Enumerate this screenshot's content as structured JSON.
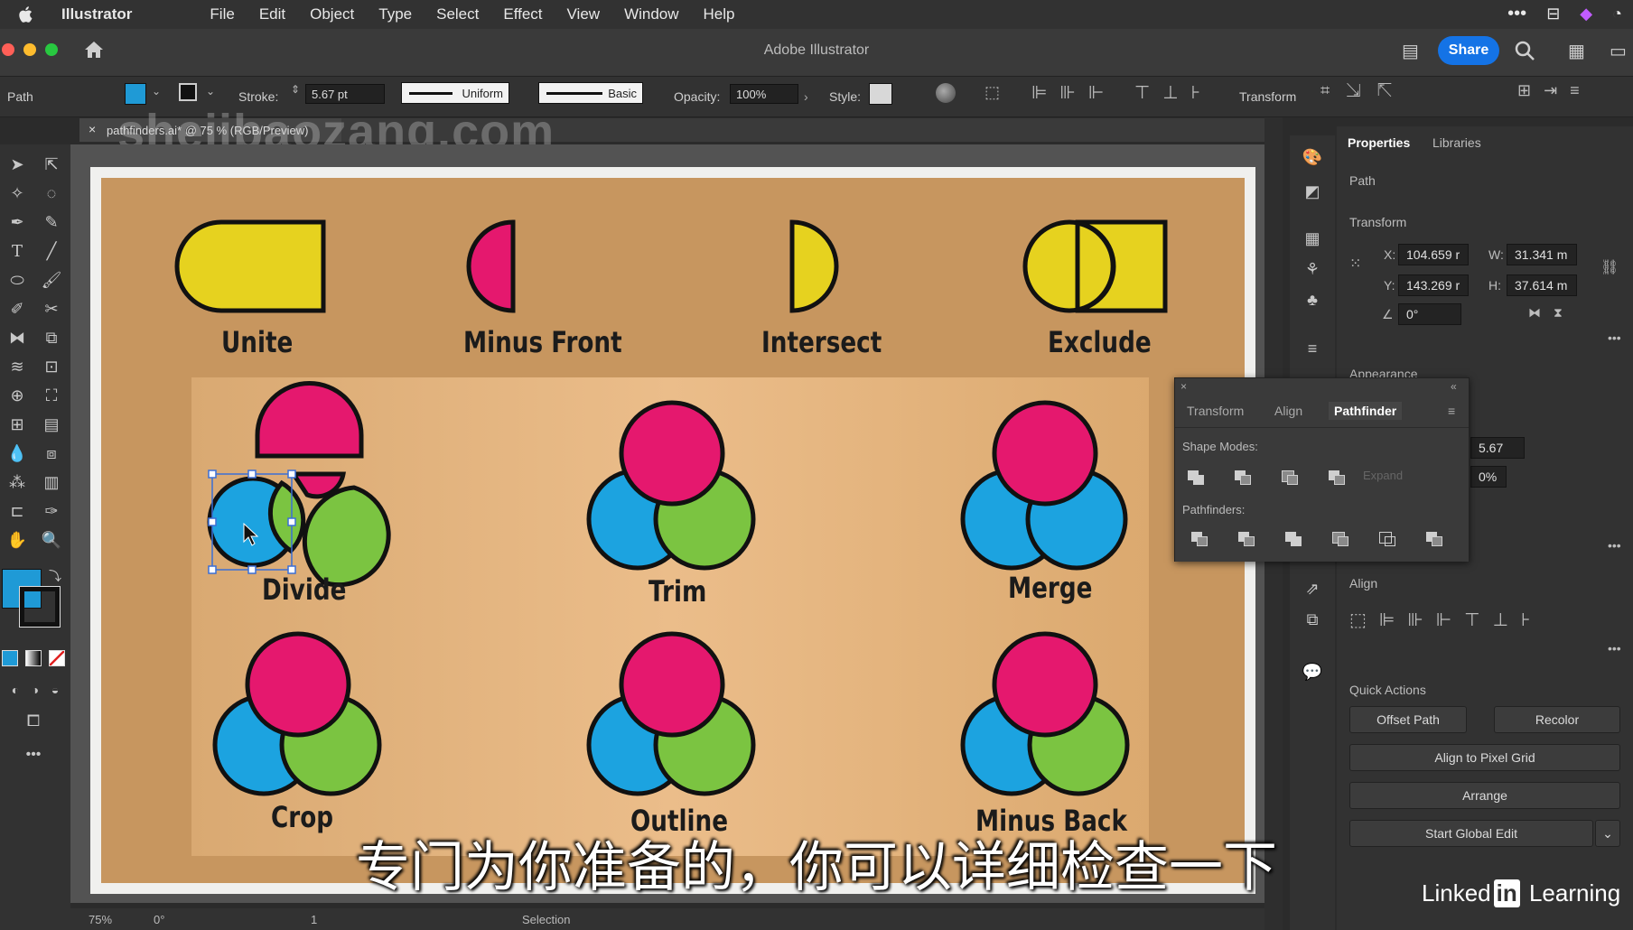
{
  "menubar": {
    "app_name": "Illustrator",
    "items": [
      "File",
      "Edit",
      "Object",
      "Type",
      "Select",
      "Effect",
      "View",
      "Window",
      "Help"
    ]
  },
  "titlebar": {
    "title": "Adobe Illustrator",
    "share_label": "Share"
  },
  "controlbar": {
    "selection_type": "Path",
    "stroke_label": "Stroke:",
    "stroke_value": "5.67 pt",
    "profile_label": "Uniform",
    "brush_label": "Basic",
    "opacity_label": "Opacity:",
    "opacity_value": "100%",
    "style_label": "Style:",
    "transform_label": "Transform",
    "fill_color": "#1f9ad6"
  },
  "document_tab": {
    "name": "pathfinders.ai* @ 75 % (RGB/Preview)",
    "watermark": "shejibaozang.com"
  },
  "artboard": {
    "labels": {
      "unite": "Unite",
      "minus_front": "Minus Front",
      "intersect": "Intersect",
      "exclude": "Exclude",
      "divide": "Divide",
      "trim": "Trim",
      "merge": "Merge",
      "crop": "Crop",
      "outline": "Outline",
      "minus_back": "Minus Back"
    },
    "colors": {
      "magenta": "#e5186e",
      "blue": "#1ca3e0",
      "green": "#7bc441",
      "yellow": "#e6d21f"
    }
  },
  "statusbar": {
    "zoom": "75%",
    "rotation": "0°",
    "artboard_number": "1",
    "tool": "Selection"
  },
  "properties_panel": {
    "tabs": [
      "Properties",
      "Libraries"
    ],
    "selection": "Path",
    "transform_heading": "Transform",
    "x_label": "X:",
    "x_value": "104.659 r",
    "y_label": "Y:",
    "y_value": "143.269 r",
    "w_label": "W:",
    "w_value": "31.341 m",
    "h_label": "H:",
    "h_value": "37.614 m",
    "angle_value": "0°",
    "appearance_heading": "Appearance",
    "stroke_weight": "5.67",
    "opacity_partial": "0%",
    "align_heading": "Align",
    "quick_actions_heading": "Quick Actions",
    "buttons": {
      "offset_path": "Offset Path",
      "recolor": "Recolor",
      "align_pixel": "Align to Pixel Grid",
      "arrange": "Arrange",
      "global_edit": "Start Global Edit"
    }
  },
  "pathfinder_panel": {
    "tabs": [
      "Transform",
      "Align",
      "Pathfinder"
    ],
    "shape_modes_label": "Shape Modes:",
    "pathfinders_label": "Pathfinders:",
    "expand_label": "Expand"
  },
  "subtitle": "专门为你准备的，你可以详细检查一下",
  "branding": {
    "prefix": "Linked",
    "in": "in",
    "suffix": "Learning"
  }
}
